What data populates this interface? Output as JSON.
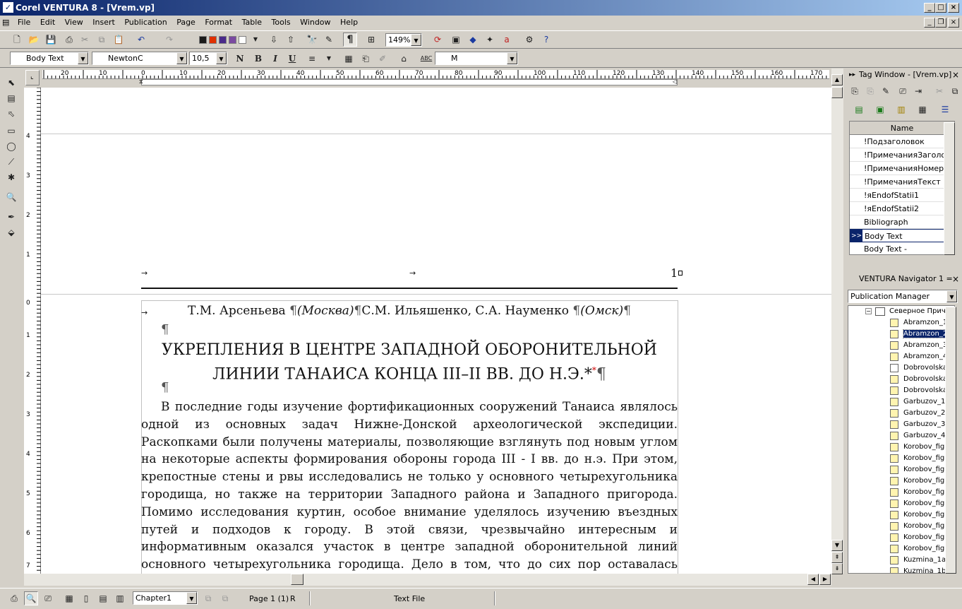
{
  "window": {
    "title": "Corel VENTURA 8 - [Vrem.vp]",
    "app_icon": "ventura-logo-icon"
  },
  "menu": [
    "File",
    "Edit",
    "View",
    "Insert",
    "Publication",
    "Page",
    "Format",
    "Table",
    "Tools",
    "Window",
    "Help"
  ],
  "toolbar": {
    "zoom": "149%",
    "colors": [
      "#1a1a1a",
      "#e03000",
      "#4a2a8a",
      "#7a4aa0",
      "#ffffff"
    ]
  },
  "format_bar": {
    "tag": "Body Text",
    "font": "NewtonC",
    "size": "10,5",
    "language": "M"
  },
  "ruler": {
    "ticks": [
      "20",
      "10",
      "0",
      "10",
      "20",
      "30",
      "40",
      "50",
      "60",
      "70",
      "80",
      "90",
      "100",
      "110",
      "120",
      "130",
      "140",
      "150",
      "160",
      "170"
    ]
  },
  "vruler": {
    "ticks": [
      "4",
      "3",
      "2",
      "1",
      "0",
      "1",
      "2",
      "3",
      "4",
      "5",
      "6",
      "7"
    ]
  },
  "header": {
    "page_number": "1"
  },
  "document": {
    "authors_1": "Т.М. Арсеньева ",
    "city_1": "(Москва)",
    "authors_2": "С.М. Ильяшенко, С.А. Науменко ",
    "city_2": "(Омск)",
    "pilcrow": "¶",
    "title_line1": "УКРЕПЛЕНИЯ В ЦЕНТРЕ ЗАПАДНОЙ ОБОРОНИТЕЛЬНОЙ",
    "title_line2": "ЛИНИИ ТАНАИСА КОНЦА III–II ВВ. ДО Н.Э.*",
    "footnote_mark": "*",
    "body": "В последние годы изучение фортификационных сооружений Танаиса являлось одной из основных задач Нижне-Донской археологической экспедиции. Раскопками были получены материалы, позволяющие взглянуть под новым углом на некоторые аспекты формирования обороны города III - I вв. до н.э. При этом, крепостные стены и рвы исследовались не только у основного четырехугольника городища, но также на территории Западного района и Западного пригорода. Помимо исследования куртин, особое внимание уделялось изучению въездных путей и подходов к городу. В этой связи, чрезвычайно интересным и информативным оказался участок в центре западной оборонительной линий основного четырехугольника городища. Дело в том, что до сих пор оставалась неясной взаимосвязь двух сосуществовавших стен и многочисленных рвов."
  },
  "tag_window": {
    "title": "Tag Window - [Vrem.vp]",
    "column": "Name",
    "items": [
      "!Подзаголовок",
      "!ПримечанияЗаголовок",
      "!ПримечанияНомер",
      "!ПримечанияТекст",
      "!яEndofStatii1",
      "!яEndofStatii2",
      "Bibliograph",
      "Body Text",
      "Body Text -"
    ],
    "selected_index": 7,
    "selected_marker": ">>"
  },
  "navigator": {
    "title": "VENTURA Navigator 1 =",
    "dropdown": "Publication Manager",
    "root": "Северное Причерн",
    "expander": "−",
    "items": [
      "Abramzon_1",
      "Abramzon_2",
      "Abramzon_3",
      "Abramzon_4",
      "Dobrovolskaya",
      "Dobrovolskaya",
      "Dobrovolskaya",
      "Garbuzov_1",
      "Garbuzov_2",
      "Garbuzov_3",
      "Garbuzov_4",
      "Korobov_fig",
      "Korobov_fig",
      "Korobov_fig",
      "Korobov_fig",
      "Korobov_fig",
      "Korobov_fig",
      "Korobov_fig",
      "Korobov_fig",
      "Korobov_fig",
      "Korobov_fig",
      "Kuzmina_1a",
      "Kuzmina_1b"
    ],
    "selected_index": 1
  },
  "status": {
    "chapter": "Chapter1",
    "page": "Page 1 (1)",
    "mode": "R",
    "file_type": "Text File"
  }
}
